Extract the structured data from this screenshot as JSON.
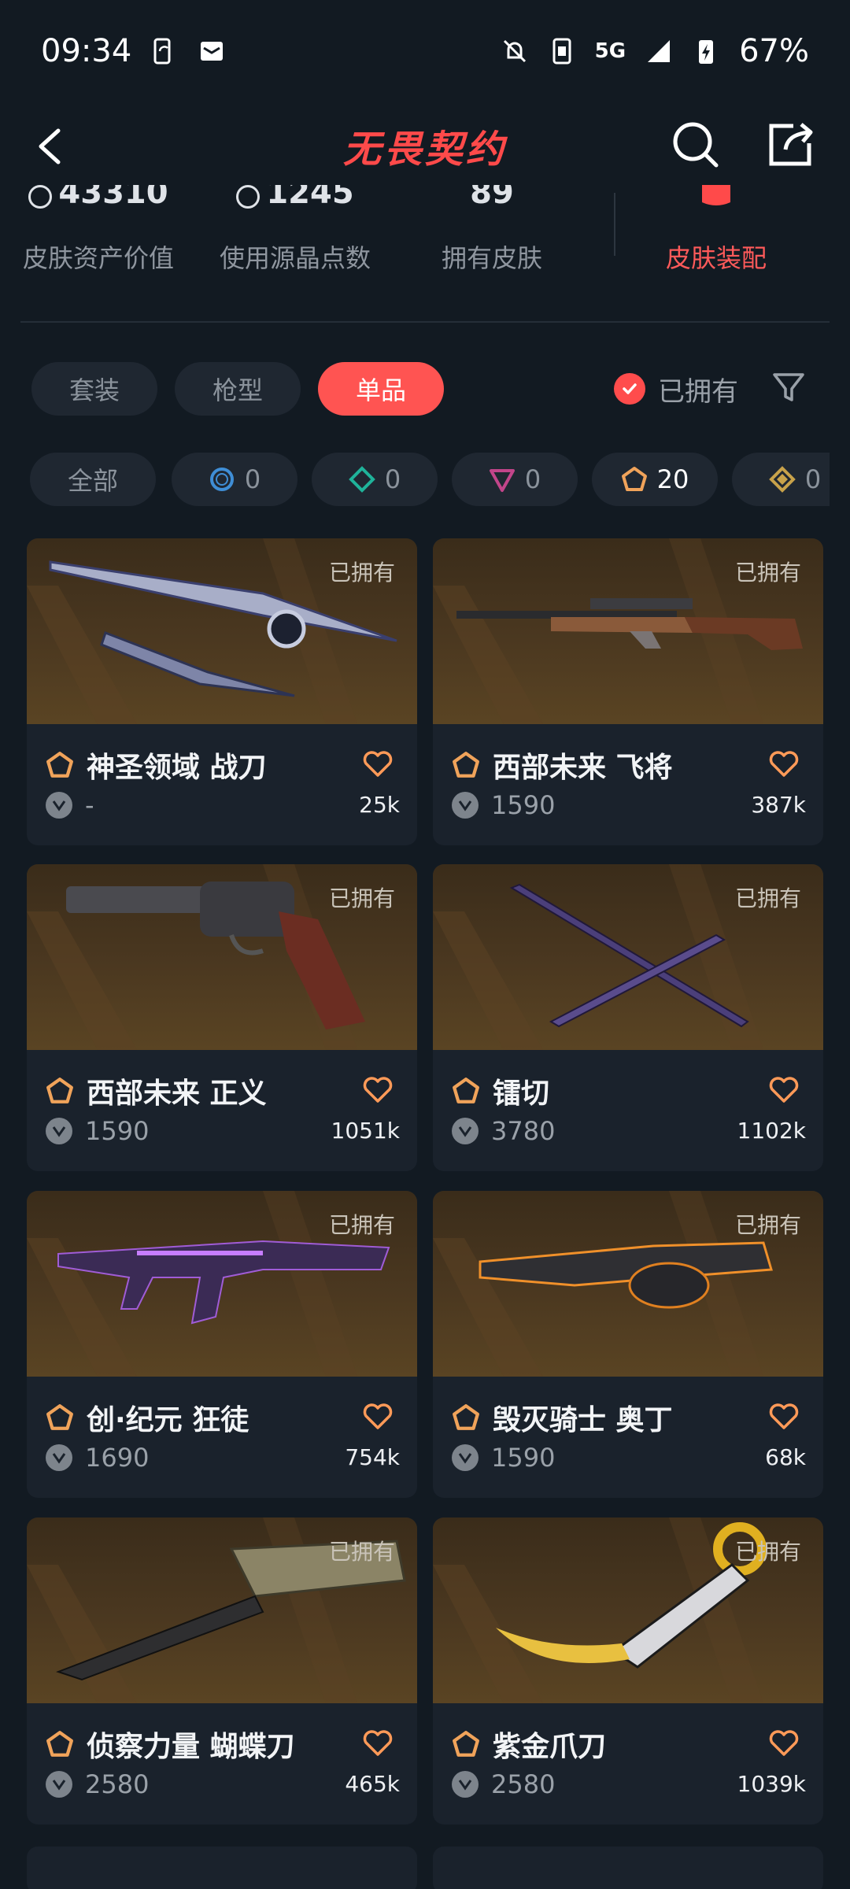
{
  "status_bar": {
    "time": "09:34",
    "network": "5G",
    "battery": "67%"
  },
  "header": {
    "title": "无畏契约"
  },
  "stats": [
    {
      "value": "43310",
      "label": "皮肤资产价值"
    },
    {
      "value": "1245",
      "label": "使用源晶点数"
    },
    {
      "value": "89",
      "label": "拥有皮肤"
    }
  ],
  "fitting": {
    "label": "皮肤装配"
  },
  "tabs": [
    {
      "label": "套装",
      "active": false
    },
    {
      "label": "枪型",
      "active": false
    },
    {
      "label": "单品",
      "active": true
    }
  ],
  "owned_filter": {
    "label": "已拥有",
    "checked": true
  },
  "rarity_chips": [
    {
      "label": "全部",
      "count": "",
      "icon": "all"
    },
    {
      "label": "",
      "count": "0",
      "icon": "select-tier-icon",
      "color": "#3f8ed6"
    },
    {
      "label": "",
      "count": "0",
      "icon": "deluxe-tier-icon",
      "color": "#1fb39a"
    },
    {
      "label": "",
      "count": "0",
      "icon": "premium-tier-icon",
      "color": "#c2458a"
    },
    {
      "label": "",
      "count": "20",
      "icon": "exclusive-tier-icon",
      "color": "#f0a35a",
      "active": true
    },
    {
      "label": "",
      "count": "0",
      "icon": "ultra-tier-icon",
      "color": "#c8a24a"
    }
  ],
  "cards": [
    {
      "owned": "已拥有",
      "name": "神圣领域 战刀",
      "price": "-",
      "likes": "25k"
    },
    {
      "owned": "已拥有",
      "name": "西部未来 飞将",
      "price": "1590",
      "likes": "387k"
    },
    {
      "owned": "已拥有",
      "name": "西部未来 正义",
      "price": "1590",
      "likes": "1051k"
    },
    {
      "owned": "已拥有",
      "name": "镭切",
      "price": "3780",
      "likes": "1102k"
    },
    {
      "owned": "已拥有",
      "name": "创·纪元 狂徒",
      "price": "1690",
      "likes": "754k"
    },
    {
      "owned": "已拥有",
      "name": "毁灭骑士 奥丁",
      "price": "1590",
      "likes": "68k"
    },
    {
      "owned": "已拥有",
      "name": "侦察力量 蝴蝶刀",
      "price": "2580",
      "likes": "465k"
    },
    {
      "owned": "已拥有",
      "name": "紫金爪刀",
      "price": "2580",
      "likes": "1039k"
    }
  ]
}
